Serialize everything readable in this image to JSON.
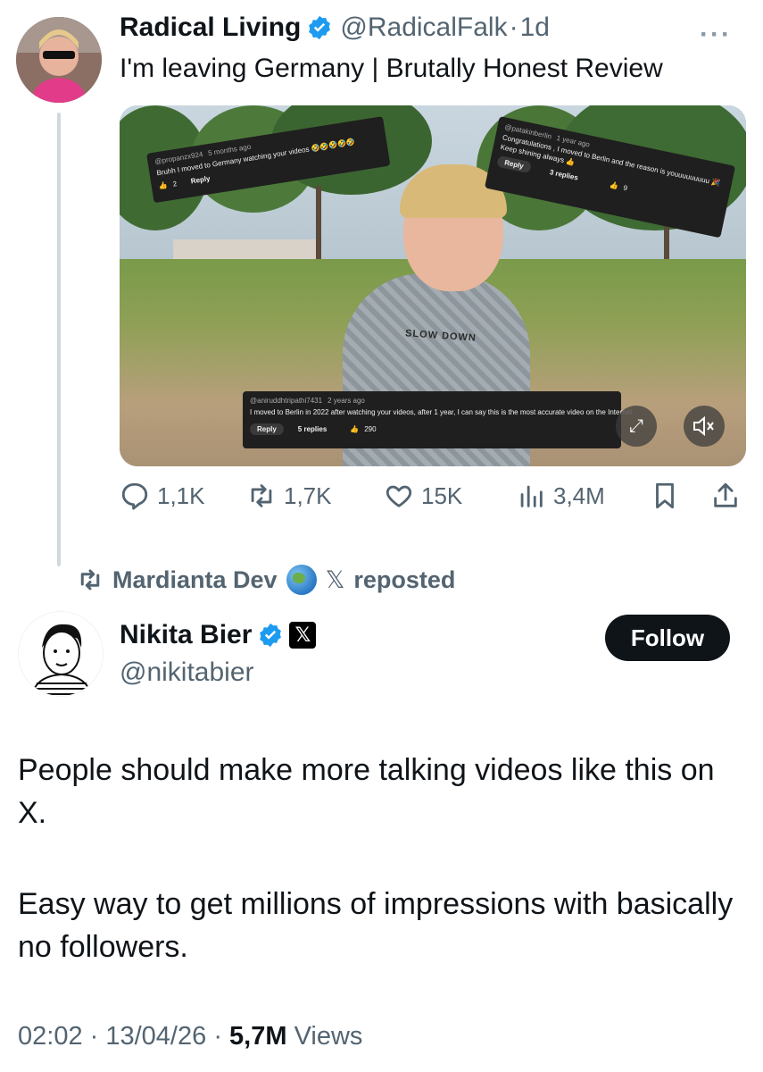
{
  "quoted_tweet": {
    "author_name": "Radical Living",
    "handle": "@RadicalFalk",
    "time": "1d",
    "text": "I'm leaving Germany | Brutally Honest Review",
    "video": {
      "comment1": {
        "user": "@propanzx924",
        "age": "5 months ago",
        "text": "Bruhh I moved to Germany watching your videos 🤣🤣🤣🤣🤣",
        "likes": "2",
        "reply_label": "Reply"
      },
      "comment2": {
        "user": "@patakinberlin",
        "age": "1 year ago",
        "text": "Congratulations , I moved to Berlin and the reason is youuuuuuuuu 🎉",
        "text2": "Keep shining always 👍",
        "reply_label": "Reply",
        "replies": "3 replies",
        "likes": "9"
      },
      "comment3": {
        "user": "@aniruddhtripathi7431",
        "age": "2 years ago",
        "text": "I moved to Berlin in 2022 after watching your videos, after 1 year, I can say this is the most accurate video on the Internet",
        "reply_label": "Reply",
        "replies": "5 replies",
        "likes": "290"
      },
      "shirt_print": "SLOW DOWN"
    },
    "stats": {
      "replies": "1,1K",
      "reposts": "1,7K",
      "likes": "15K",
      "views": "3,4M"
    }
  },
  "repost": {
    "user": "Mardianta Dev",
    "label": "reposted"
  },
  "main_tweet": {
    "author_name": "Nikita Bier",
    "handle": "@nikitabier",
    "follow_label": "Follow",
    "paragraph1": "People should make more talking videos like this on X.",
    "paragraph2": "Easy way to get millions of impressions with basically no followers.",
    "time": "02:02",
    "date": "13/04/26",
    "views_count": "5,7M",
    "views_label": "Views"
  },
  "colors": {
    "verified_blue": "#1d9bf0",
    "text_primary": "#0f1419",
    "text_secondary": "#536471"
  }
}
